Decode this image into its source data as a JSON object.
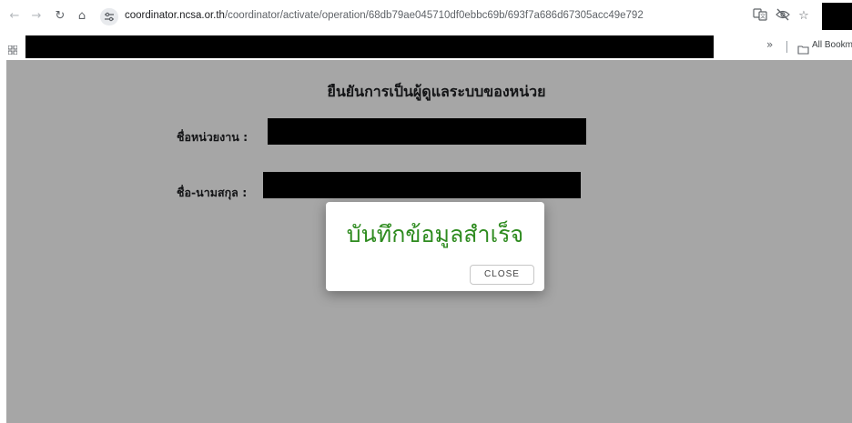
{
  "browser": {
    "url_host": "coordinator.ncsa.or.th",
    "url_path": "/coordinator/activate/operation/68db79ae045710df0ebbc69b/693f7a686d67305acc49e792",
    "bookmarks_more": "»",
    "bookmarks_label": "All Bookma"
  },
  "page": {
    "title": "ยืนยันการเป็นผู้ดูแลระบบของหน่วย",
    "fields": [
      {
        "label": "ชื่อหน่วยงาน :"
      },
      {
        "label": "ชื่อ-นามสกุล :"
      }
    ]
  },
  "dialog": {
    "message": "บันทึกข้อมูลสำเร็จ",
    "close_label": "CLOSE"
  },
  "colors": {
    "success_text": "#2e8b1f",
    "overlay": "rgba(0,0,0,0.35)"
  }
}
